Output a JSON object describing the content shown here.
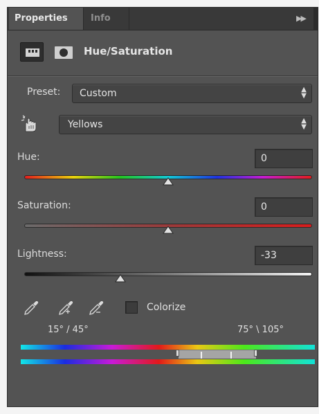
{
  "tabs": [
    {
      "label": "Properties",
      "active": true
    },
    {
      "label": "Info",
      "active": false
    }
  ],
  "panel_menu_icon": "double-chevron-right-icon",
  "header": {
    "adjustment_icon": "hue-saturation-adjustment-icon",
    "mask_icon": "layer-mask-icon",
    "title": "Hue/Saturation"
  },
  "preset": {
    "label": "Preset:",
    "value": "Custom"
  },
  "channel": {
    "tool_icon": "on-image-adjust-hand-icon",
    "value": "Yellows"
  },
  "sliders": {
    "hue": {
      "label": "Hue:",
      "value": "0",
      "position": 0.5
    },
    "saturation": {
      "label": "Saturation:",
      "value": "0",
      "position": 0.5
    },
    "lightness": {
      "label": "Lightness:",
      "value": "-33",
      "position": 0.335
    }
  },
  "tools": {
    "eyedroppers": [
      "eyedropper-icon",
      "eyedropper-plus-icon",
      "eyedropper-minus-icon"
    ],
    "colorize": {
      "label": "Colorize",
      "checked": false
    }
  },
  "range": {
    "left": "15° / 45°",
    "right": "75° \\ 105°"
  },
  "colors": {
    "panel_bg": "#535353",
    "tab_bar_bg": "#393939",
    "value_box_bg": "#3f3f3f"
  }
}
